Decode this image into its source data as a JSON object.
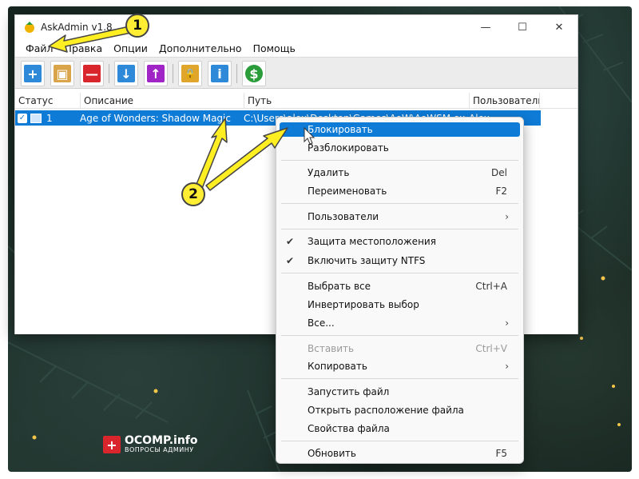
{
  "window": {
    "title": "AskAdmin v1.8",
    "minimize_glyph": "—",
    "maximize_glyph": "☐",
    "close_glyph": "✕"
  },
  "menu": [
    "Файл",
    "Правка",
    "Опции",
    "Дополнительно",
    "Помощь"
  ],
  "toolbar": {
    "buttons": [
      {
        "icon": "add-icon",
        "glyph": "+",
        "color": "#2e8ad8"
      },
      {
        "icon": "add-folder-icon",
        "glyph": "▣",
        "color": "#d9a44a"
      },
      {
        "icon": "remove-icon",
        "glyph": "—",
        "color": "#d9262c"
      },
      {
        "icon": "move-down-icon",
        "glyph": "↓",
        "color": "#2e8ad8"
      },
      {
        "icon": "move-up-icon",
        "glyph": "↑",
        "color": "#a024c6"
      },
      {
        "icon": "lock-icon",
        "glyph": "🔒",
        "color": "#e0a52b"
      },
      {
        "icon": "info-icon",
        "glyph": "i",
        "color": "#2e8ad8"
      },
      {
        "icon": "donate-icon",
        "glyph": "$",
        "color": "#2a9c3a"
      }
    ]
  },
  "columns": [
    "Статус",
    "Описание",
    "Путь",
    "Пользователь"
  ],
  "rows": [
    {
      "status": "1",
      "description": "Age of Wonders: Shadow Magic",
      "path": "C:\\Users\\alex\\Desktop\\Games\\AoW\\AoWSM.exe",
      "user": "Alex"
    }
  ],
  "context_menu": {
    "items": [
      {
        "label": "Блокировать",
        "shortcut": "",
        "highlighted": true
      },
      {
        "label": "Разблокировать",
        "shortcut": ""
      },
      {
        "label": "Удалить",
        "shortcut": "Del"
      },
      {
        "label": "Переименовать",
        "shortcut": "F2"
      },
      {
        "label": "Пользователи",
        "submenu": true
      },
      {
        "label": "Защита местоположения",
        "checked": true
      },
      {
        "label": "Включить защиту NTFS",
        "checked": true
      },
      {
        "label": "Выбрать все",
        "shortcut": "Ctrl+A"
      },
      {
        "label": "Инвертировать выбор",
        "shortcut": ""
      },
      {
        "label": "Все...",
        "submenu": true
      },
      {
        "label": "Вставить",
        "shortcut": "Ctrl+V",
        "disabled": true
      },
      {
        "label": "Копировать",
        "submenu": true
      },
      {
        "label": "Запустить файл",
        "shortcut": ""
      },
      {
        "label": "Открыть расположение файла",
        "shortcut": ""
      },
      {
        "label": "Свойства файла",
        "shortcut": ""
      },
      {
        "label": "Обновить",
        "shortcut": "F5"
      }
    ],
    "check_glyph": "✔",
    "chevron_glyph": "›"
  },
  "annotations": {
    "badge1": "1",
    "badge2": "2"
  },
  "watermark": {
    "name": "OCOMP.info",
    "tagline": "ВОПРОСЫ АДМИНУ",
    "mark": "+"
  }
}
